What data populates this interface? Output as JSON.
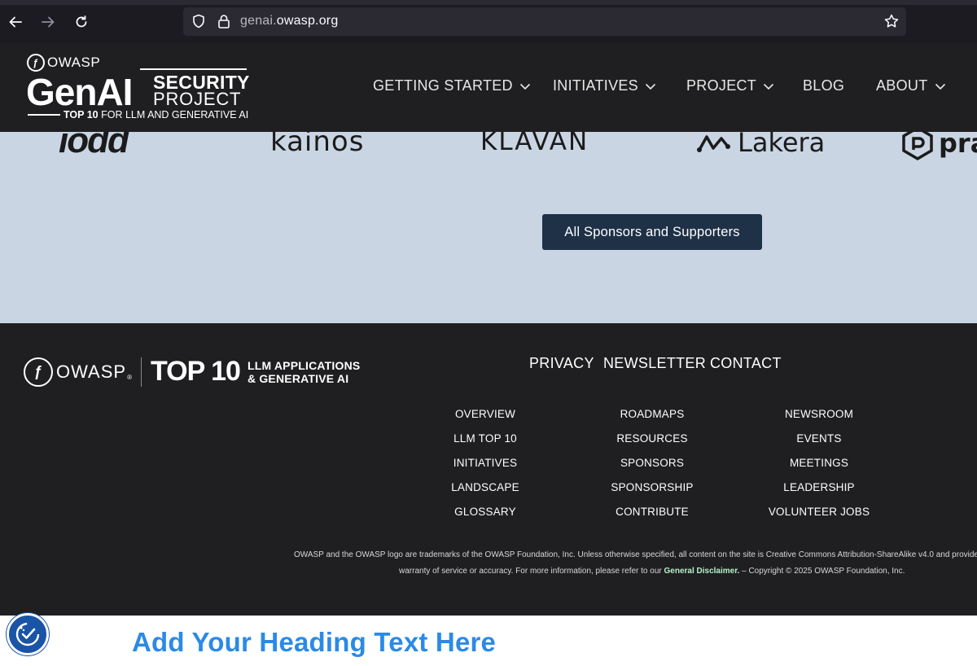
{
  "browser": {
    "url_prefix": "genai.",
    "url_host": "owasp.org"
  },
  "header": {
    "logo": {
      "owasp": "OWASP",
      "genai": "GenAI",
      "security": "SECURITY",
      "project": "PROJECT",
      "tagline_bold": "TOP 10",
      "tagline_rest": "FOR LLM AND GENERATIVE AI"
    },
    "nav": [
      {
        "label": "GETTING STARTED",
        "has_dropdown": true
      },
      {
        "label": "INITIATIVES",
        "has_dropdown": true
      },
      {
        "label": "PROJECT",
        "has_dropdown": true
      },
      {
        "label": "BLOG",
        "has_dropdown": false
      },
      {
        "label": "ABOUT",
        "has_dropdown": true
      }
    ]
  },
  "sponsors": {
    "logos": [
      "iodd",
      "kainos",
      "KLAVAN",
      "Lakera",
      "pra"
    ],
    "button_label": "All Sponsors and Supporters"
  },
  "footer": {
    "logo": {
      "owasp": "OWASP",
      "top10": "TOP 10",
      "line1": "LLM APPLICATIONS",
      "line2": "& GENERATIVE AI"
    },
    "top_links": [
      "PRIVACY",
      "NEWSLETTER",
      "CONTACT"
    ],
    "columns": [
      [
        "OVERVIEW",
        "LLM TOP 10",
        "INITIATIVES",
        "LANDSCAPE",
        "GLOSSARY"
      ],
      [
        "ROADMAPS",
        "RESOURCES",
        "SPONSORS",
        "SPONSORSHIP",
        "CONTRIBUTE"
      ],
      [
        "NEWSROOM",
        "EVENTS",
        "MEETINGS",
        "LEADERSHIP",
        "VOLUNTEER JOBS"
      ]
    ],
    "legal_line1": "OWASP and the OWASP logo are trademarks of the OWASP Foundation, Inc. Unless otherwise specified, all content on the site is Creative Commons Attribution-ShareAlike v4.0 and provide",
    "legal_line2_pre": "warranty of service or accuracy. For more information, please refer to our",
    "legal_disclaimer": "General Disclaimer.",
    "legal_line2_post": " – Copyright © 2025 OWASP Foundation, Inc."
  },
  "bottom": {
    "heading": "Add Your Heading Text Here"
  },
  "colors": {
    "page_dark": "#1f1f21",
    "sponsor_band": "#c9d5e3",
    "sponsor_button": "#1e3147",
    "heading_blue": "#2b8ae6",
    "a11y_blue": "#1a54a6"
  }
}
